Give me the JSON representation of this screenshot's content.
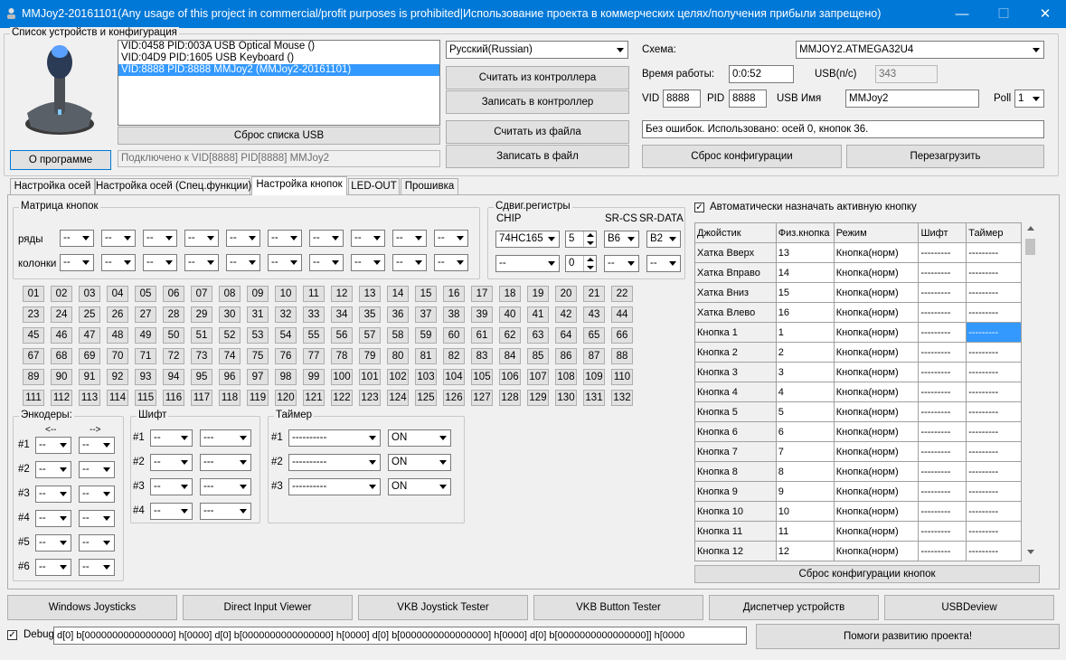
{
  "title": "MMJoy2-20161101(Any usage of this project in commercial/profit purposes is prohibited|Использование проекта в коммерческих целях/получения прибыли запрещено)",
  "window_buttons": {
    "minimize": "—",
    "maximize": "☐",
    "close": "✕"
  },
  "devices": {
    "label": "Список устройств и конфигурация",
    "items": [
      "VID:0458 PID:003A USB Optical Mouse ()",
      "VID:04D9 PID:1605 USB Keyboard ()",
      "VID:8888 PID:8888 MMJoy2 (MMJoy2-20161101)"
    ],
    "reset_usb": "Сброс списка USB",
    "about": "О программе",
    "connected": "Подключено к VID[8888] PID[8888] MMJoy2",
    "language": "Русский(Russian)",
    "read_ctrl": "Считать из контроллера",
    "write_ctrl": "Записать в контроллер",
    "read_file": "Считать из файла",
    "write_file": "Записать в файл",
    "scheme_label": "Схема:",
    "scheme": "MMJOY2.ATMEGA32U4",
    "uptime_label": "Время работы:",
    "uptime": "0:0:52",
    "usb_label": "USB(п/с)",
    "usb": "343",
    "vid_label": "VID",
    "vid": "8888",
    "pid_label": "PID",
    "pid": "8888",
    "usbname_label": "USB Имя",
    "usbname": "MMJoy2",
    "poll_label": "Poll",
    "poll": "1",
    "status": "Без ошибок. Использовано: осей  0, кнопок  36.",
    "reset_config": "Сброс конфигурации",
    "reboot": "Перезагрузить"
  },
  "tabs": [
    "Настройка осей",
    "Настройка осей (Спец.функции)",
    "Настройка кнопок",
    "LED-OUT",
    "Прошивка"
  ],
  "matrix": {
    "label": "Матрица кнопок",
    "rows_label": "ряды",
    "cols_label": "колонки",
    "dash": "--"
  },
  "shift_reg": {
    "label": "Сдвиг.регистры",
    "chip_label": "CHIP",
    "srcs_label": "SR-CS",
    "srdata_label": "SR-DATA",
    "chip": "74HC165",
    "count": "5",
    "cs": "B6",
    "data": "B2",
    "chip2": "--",
    "count2": "0",
    "cs2": "--",
    "data2": "--"
  },
  "button_numbers": [
    "01",
    "02",
    "03",
    "04",
    "05",
    "06",
    "07",
    "08",
    "09",
    "10",
    "11",
    "12",
    "13",
    "14",
    "15",
    "16",
    "17",
    "18",
    "19",
    "20",
    "21",
    "22",
    "23",
    "24",
    "25",
    "26",
    "27",
    "28",
    "29",
    "30",
    "31",
    "32",
    "33",
    "34",
    "35",
    "36",
    "37",
    "38",
    "39",
    "40",
    "41",
    "42",
    "43",
    "44",
    "45",
    "46",
    "47",
    "48",
    "49",
    "50",
    "51",
    "52",
    "53",
    "54",
    "55",
    "56",
    "57",
    "58",
    "59",
    "60",
    "61",
    "62",
    "63",
    "64",
    "65",
    "66",
    "67",
    "68",
    "69",
    "70",
    "71",
    "72",
    "73",
    "74",
    "75",
    "76",
    "77",
    "78",
    "79",
    "80",
    "81",
    "82",
    "83",
    "84",
    "85",
    "86",
    "87",
    "88",
    "89",
    "90",
    "91",
    "92",
    "93",
    "94",
    "95",
    "96",
    "97",
    "98",
    "99",
    "100",
    "101",
    "102",
    "103",
    "104",
    "105",
    "106",
    "107",
    "108",
    "109",
    "110",
    "111",
    "112",
    "113",
    "114",
    "115",
    "116",
    "117",
    "118",
    "119",
    "120",
    "121",
    "122",
    "123",
    "124",
    "125",
    "126",
    "127",
    "128",
    "129",
    "130",
    "131",
    "132"
  ],
  "encoders": {
    "label": "Энкодеры:",
    "left": "<--",
    "right": "-->",
    "rows": [
      "#1",
      "#2",
      "#3",
      "#4",
      "#5",
      "#6"
    ],
    "value": "--"
  },
  "shift": {
    "label": "Шифт",
    "rows": [
      "#1",
      "#2",
      "#3",
      "#4"
    ],
    "value": "--",
    "value2": "---"
  },
  "timer": {
    "label": "Таймер",
    "rows": [
      "#1",
      "#2",
      "#3"
    ],
    "value": "----------",
    "state": "ON"
  },
  "auto_assign": "Автоматически назначать активную кнопку",
  "grid": {
    "headers": [
      "Джойстик",
      "Физ.кнопка",
      "Режим",
      "Шифт",
      "Таймер"
    ],
    "rows": [
      [
        "Хатка Вверх",
        "13",
        "Кнопка(норм)",
        "---------",
        "---------"
      ],
      [
        "Хатка Вправо",
        "14",
        "Кнопка(норм)",
        "---------",
        "---------"
      ],
      [
        "Хатка Вниз",
        "15",
        "Кнопка(норм)",
        "---------",
        "---------"
      ],
      [
        "Хатка Влево",
        "16",
        "Кнопка(норм)",
        "---------",
        "---------"
      ],
      [
        "Кнопка 1",
        "1",
        "Кнопка(норм)",
        "---------",
        "---------"
      ],
      [
        "Кнопка 2",
        "2",
        "Кнопка(норм)",
        "---------",
        "---------"
      ],
      [
        "Кнопка 3",
        "3",
        "Кнопка(норм)",
        "---------",
        "---------"
      ],
      [
        "Кнопка 4",
        "4",
        "Кнопка(норм)",
        "---------",
        "---------"
      ],
      [
        "Кнопка 5",
        "5",
        "Кнопка(норм)",
        "---------",
        "---------"
      ],
      [
        "Кнопка 6",
        "6",
        "Кнопка(норм)",
        "---------",
        "---------"
      ],
      [
        "Кнопка 7",
        "7",
        "Кнопка(норм)",
        "---------",
        "---------"
      ],
      [
        "Кнопка 8",
        "8",
        "Кнопка(норм)",
        "---------",
        "---------"
      ],
      [
        "Кнопка 9",
        "9",
        "Кнопка(норм)",
        "---------",
        "---------"
      ],
      [
        "Кнопка 10",
        "10",
        "Кнопка(норм)",
        "---------",
        "---------"
      ],
      [
        "Кнопка 11",
        "11",
        "Кнопка(норм)",
        "---------",
        "---------"
      ],
      [
        "Кнопка 12",
        "12",
        "Кнопка(норм)",
        "---------",
        "---------"
      ]
    ],
    "reset": "Сброс конфигурации кнопок"
  },
  "bottom": [
    "Windows Joysticks",
    "Direct Input Viewer",
    "VKB Joystick Tester",
    "VKB Button Tester",
    "Диспетчер устройств",
    "USBDeview"
  ],
  "debug_label": "Debug",
  "debug": "d[0] b[0000000000000000] h[0000]   d[0] b[0000000000000000] h[0000]   d[0] b[0000000000000000] h[0000]   d[0] b[0000000000000000]] h[0000",
  "help": "Помоги развитию проекта!"
}
